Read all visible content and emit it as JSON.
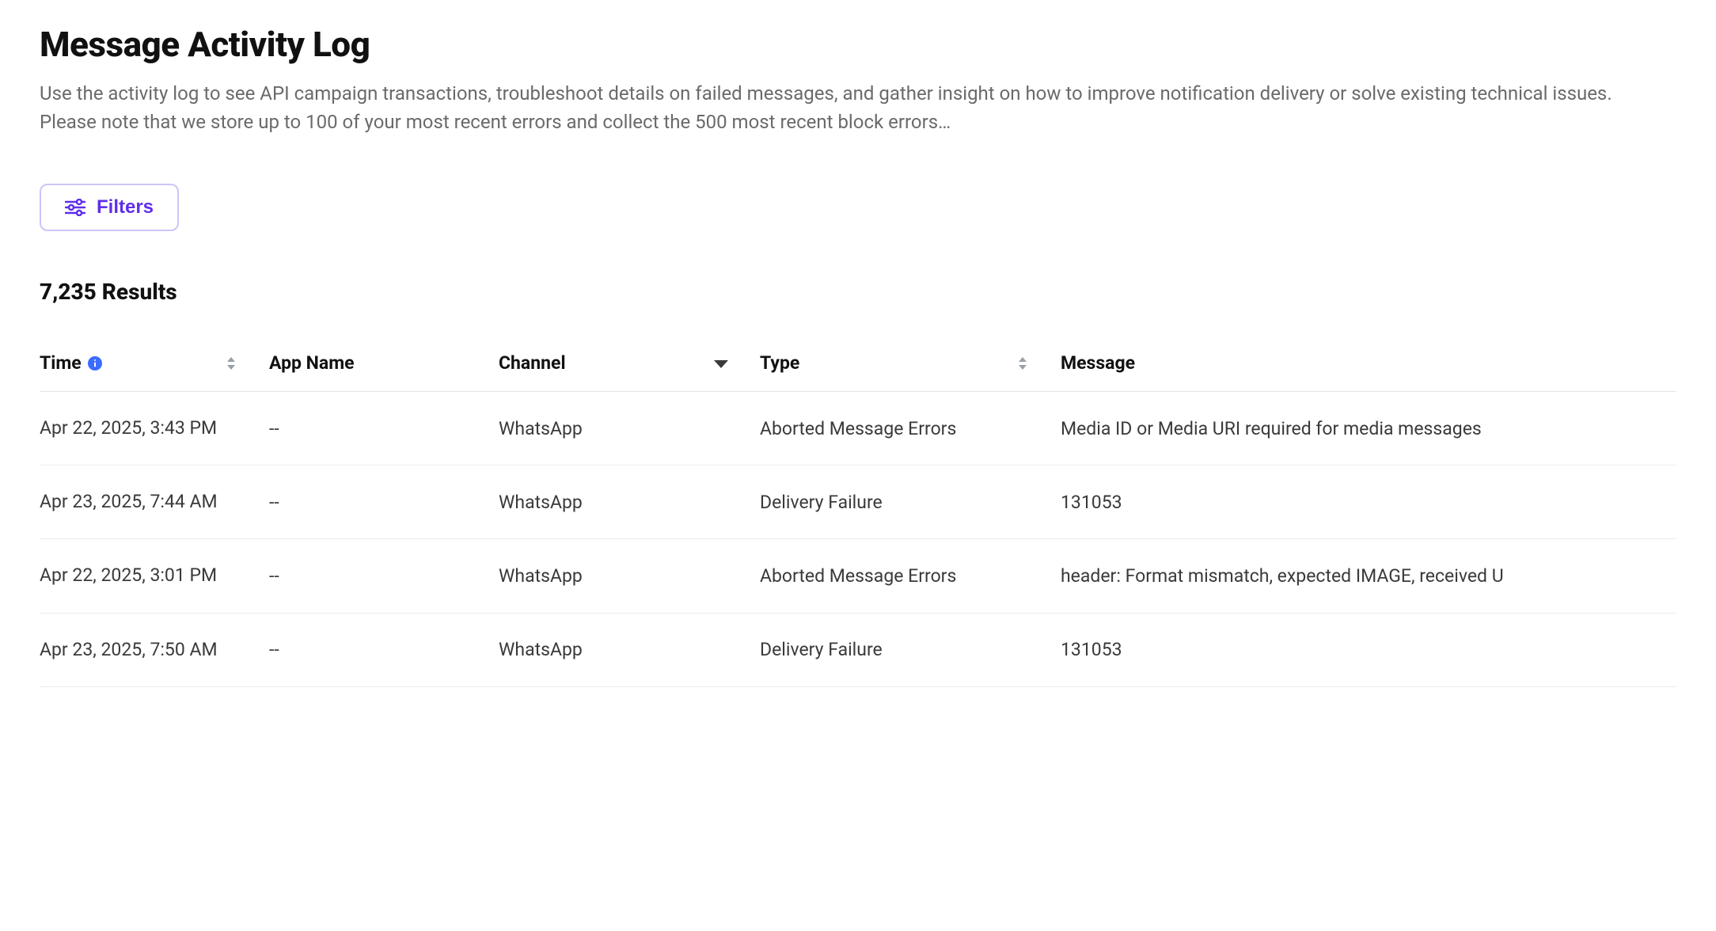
{
  "header": {
    "title": "Message Activity Log",
    "description": "Use the activity log to see API campaign transactions, troubleshoot details on failed messages, and gather insight on how to improve notification delivery or solve existing technical issues. Please note that we store up to 100 of your most recent errors and collect the 500 most recent block errors…"
  },
  "toolbar": {
    "filters_label": "Filters"
  },
  "results": {
    "count_text": "7,235 Results"
  },
  "table": {
    "columns": {
      "time": "Time",
      "app": "App Name",
      "channel": "Channel",
      "type": "Type",
      "message": "Message"
    },
    "rows": [
      {
        "time": "Apr 22, 2025, 3:43 PM",
        "app": "--",
        "channel": "WhatsApp",
        "type": "Aborted Message Errors",
        "message": "Media ID or Media URI required for media messages"
      },
      {
        "time": "Apr 23, 2025, 7:44 AM",
        "app": "--",
        "channel": "WhatsApp",
        "type": "Delivery Failure",
        "message": "131053"
      },
      {
        "time": "Apr 22, 2025, 3:01 PM",
        "app": "--",
        "channel": "WhatsApp",
        "type": "Aborted Message Errors",
        "message": "header: Format mismatch, expected IMAGE, received U"
      },
      {
        "time": "Apr 23, 2025, 7:50 AM",
        "app": "--",
        "channel": "WhatsApp",
        "type": "Delivery Failure",
        "message": "131053"
      }
    ]
  }
}
